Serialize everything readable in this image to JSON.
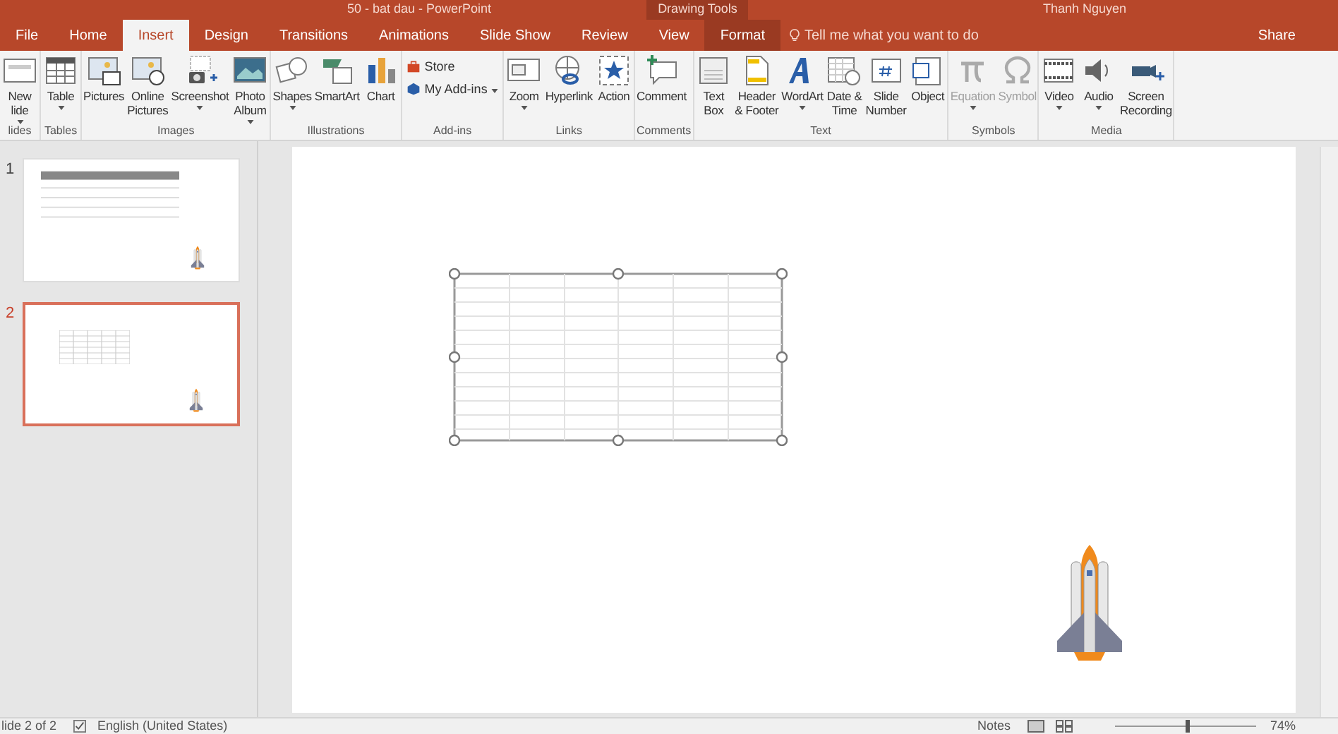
{
  "window": {
    "title": "50 - bat dau - PowerPoint",
    "context_label": "Drawing Tools",
    "user": "Thanh Nguyen"
  },
  "tabs": [
    {
      "label": "File",
      "selected": false,
      "kind": "file"
    },
    {
      "label": "Home",
      "selected": false
    },
    {
      "label": "Insert",
      "selected": true
    },
    {
      "label": "Design",
      "selected": false
    },
    {
      "label": "Transitions",
      "selected": false
    },
    {
      "label": "Animations",
      "selected": false
    },
    {
      "label": "Slide Show",
      "selected": false
    },
    {
      "label": "Review",
      "selected": false
    },
    {
      "label": "View",
      "selected": false
    },
    {
      "label": "Format",
      "selected": false,
      "kind": "context"
    }
  ],
  "tell_me": {
    "placeholder": "Tell me what you want to do"
  },
  "share": "Share",
  "ribbon": [
    {
      "group": "lides",
      "buttons": [
        {
          "lines": [
            "New",
            "lide"
          ],
          "dropdown": true,
          "disabled": false
        }
      ]
    },
    {
      "group": "Tables",
      "buttons": [
        {
          "lines": [
            "Table"
          ],
          "dropdown": true,
          "disabled": false
        }
      ]
    },
    {
      "group": "Images",
      "buttons": [
        {
          "lines": [
            "Pictures"
          ],
          "dropdown": false,
          "disabled": false
        },
        {
          "lines": [
            "Online",
            "Pictures"
          ],
          "dropdown": false,
          "disabled": false
        },
        {
          "lines": [
            "Screenshot"
          ],
          "dropdown": true,
          "disabled": false
        },
        {
          "lines": [
            "Photo",
            "Album"
          ],
          "dropdown": true,
          "disabled": false
        }
      ]
    },
    {
      "group": "Illustrations",
      "buttons": [
        {
          "lines": [
            "Shapes"
          ],
          "dropdown": true,
          "disabled": false
        },
        {
          "lines": [
            "SmartArt"
          ],
          "dropdown": false,
          "disabled": false
        },
        {
          "lines": [
            "Chart"
          ],
          "dropdown": false,
          "disabled": false
        }
      ]
    },
    {
      "group": "Add-ins",
      "kind": "small",
      "buttons": [
        {
          "lines": [
            "Store"
          ],
          "dropdown": false,
          "disabled": false
        },
        {
          "lines": [
            "My Add-ins"
          ],
          "dropdown": true,
          "disabled": false
        }
      ]
    },
    {
      "group": "Links",
      "buttons": [
        {
          "lines": [
            "Zoom"
          ],
          "dropdown": true,
          "disabled": false
        },
        {
          "lines": [
            "Hyperlink"
          ],
          "dropdown": false,
          "disabled": false
        },
        {
          "lines": [
            "Action"
          ],
          "dropdown": false,
          "disabled": false
        }
      ]
    },
    {
      "group": "Comments",
      "buttons": [
        {
          "lines": [
            "Comment"
          ],
          "dropdown": false,
          "disabled": false
        }
      ]
    },
    {
      "group": "Text",
      "buttons": [
        {
          "lines": [
            "Text",
            "Box"
          ],
          "dropdown": false,
          "disabled": false
        },
        {
          "lines": [
            "Header",
            "& Footer"
          ],
          "dropdown": false,
          "disabled": false
        },
        {
          "lines": [
            "WordArt"
          ],
          "dropdown": true,
          "disabled": false
        },
        {
          "lines": [
            "Date &",
            "Time"
          ],
          "dropdown": false,
          "disabled": false
        },
        {
          "lines": [
            "Slide",
            "Number"
          ],
          "dropdown": false,
          "disabled": false
        },
        {
          "lines": [
            "Object"
          ],
          "dropdown": false,
          "disabled": false
        }
      ]
    },
    {
      "group": "Symbols",
      "buttons": [
        {
          "lines": [
            "Equation"
          ],
          "dropdown": true,
          "disabled": true
        },
        {
          "lines": [
            "Symbol"
          ],
          "dropdown": false,
          "disabled": true
        }
      ]
    },
    {
      "group": "Media",
      "buttons": [
        {
          "lines": [
            "Video"
          ],
          "dropdown": true,
          "disabled": false
        },
        {
          "lines": [
            "Audio"
          ],
          "dropdown": true,
          "disabled": false
        },
        {
          "lines": [
            "Screen",
            "Recording"
          ],
          "dropdown": false,
          "disabled": false
        }
      ]
    }
  ],
  "slides": [
    {
      "number": "1",
      "selected": false
    },
    {
      "number": "2",
      "selected": true
    }
  ],
  "status_bar": {
    "slide": "lide 2 of 2",
    "language": "English (United States)",
    "notes": "Notes",
    "zoom": {
      "level": 0.5,
      "reading": "74%"
    }
  }
}
